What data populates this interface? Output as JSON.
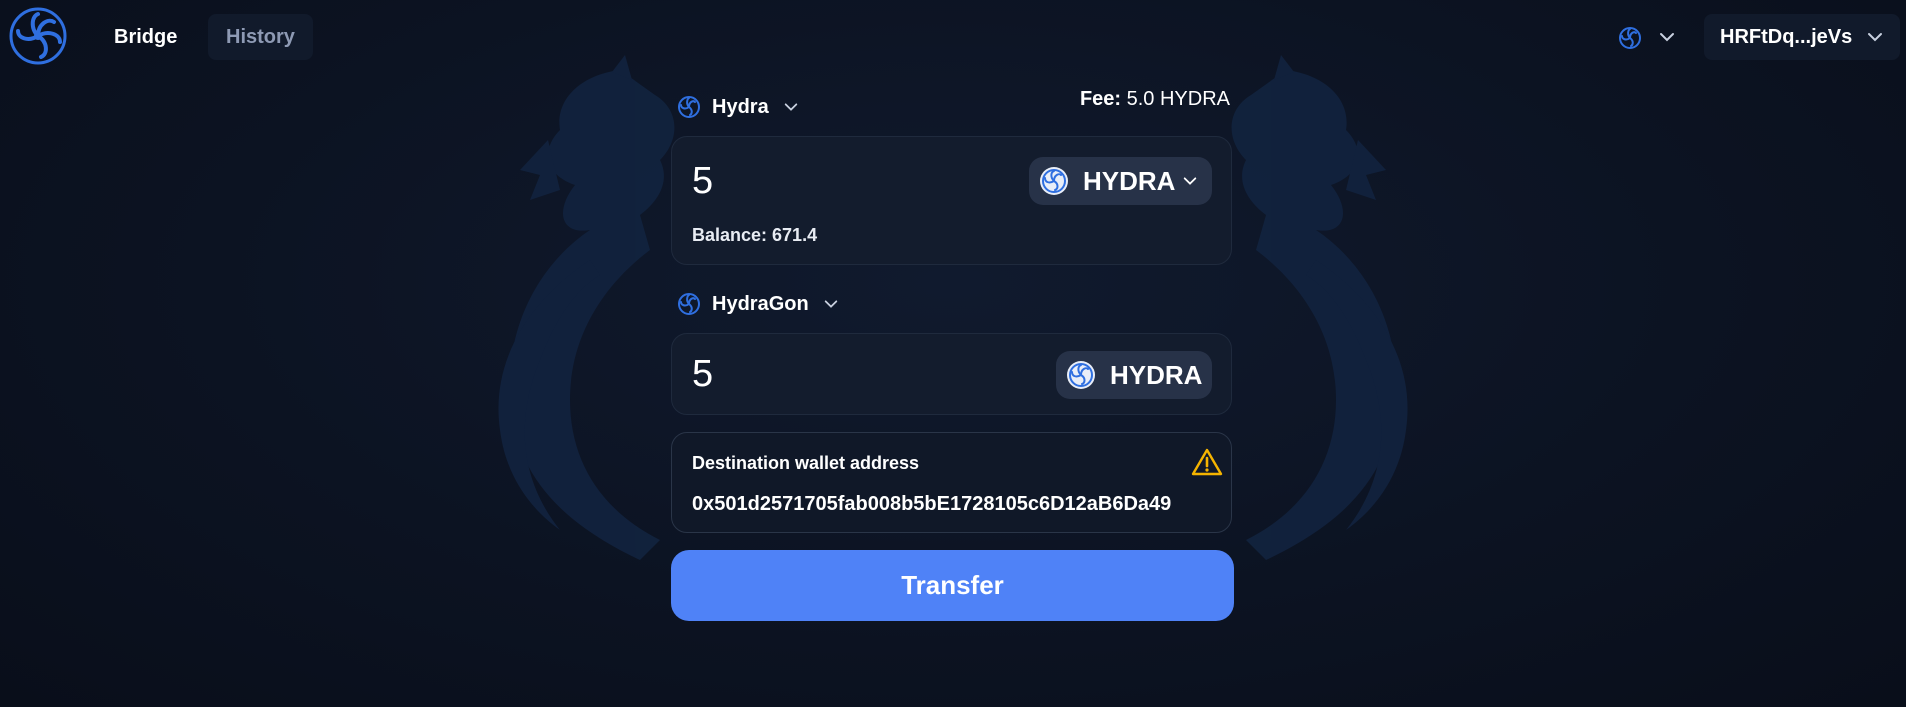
{
  "colors": {
    "background": "#0c1322",
    "panel": "#131c2d",
    "accent_button": "#4f82f7",
    "token_pill": "#273248",
    "warning": "#f5b400",
    "brand_logo": "#2f6fe0",
    "muted_text": "#8e9ab4"
  },
  "header": {
    "nav": [
      {
        "label": "Bridge",
        "active": true
      },
      {
        "label": "History",
        "active": false
      }
    ],
    "network_icon": "hydra-logo-icon",
    "account_label": "HRFtDq...jeVs"
  },
  "from": {
    "chain_name": "Hydra",
    "fee_label": "Fee:",
    "fee_value": "5.0 HYDRA",
    "amount": "5",
    "token_symbol": "HYDRA",
    "balance_text": "Balance: 671.4"
  },
  "to": {
    "chain_name": "HydraGon",
    "amount": "5",
    "token_symbol": "HYDRA"
  },
  "destination": {
    "label": "Destination wallet address",
    "address": "0x501d2571705fab008b5bE1728105c6D12aB6Da49",
    "warning_icon": "warning-triangle-icon"
  },
  "transfer_button": "Transfer"
}
